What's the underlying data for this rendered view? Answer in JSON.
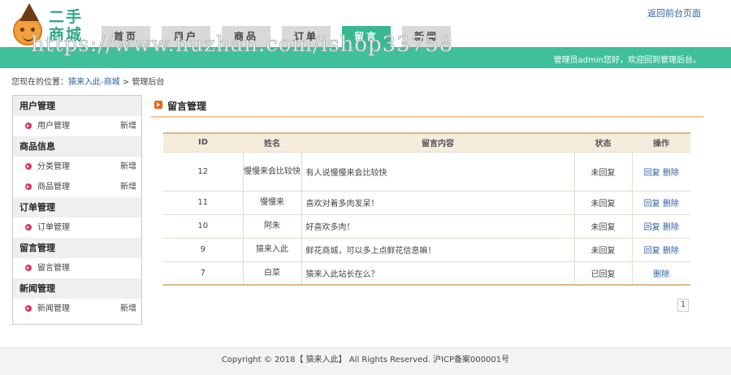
{
  "header": {
    "logo_line1": "二手",
    "logo_line2": "商城",
    "back_link": "返回前台页面",
    "welcome": "管理员admin您好，欢迎回到管理后台。",
    "watermark": "https://www.huzhan.com/ishop33758"
  },
  "nav": {
    "tabs": [
      {
        "label": "首页",
        "active": false
      },
      {
        "label": "用户",
        "active": false
      },
      {
        "label": "商品",
        "active": false
      },
      {
        "label": "订单",
        "active": false
      },
      {
        "label": "留言",
        "active": true
      },
      {
        "label": "新闻",
        "active": false
      }
    ]
  },
  "breadcrumb": {
    "prefix": "您现在的位置：",
    "site": "猿来入此-商城",
    "sep": ">",
    "current": "管理后台"
  },
  "sidebar": {
    "groups": [
      {
        "title": "用户管理",
        "items": [
          {
            "label": "用户管理",
            "add": "新增"
          }
        ]
      },
      {
        "title": "商品信息",
        "items": [
          {
            "label": "分类管理",
            "add": "新增"
          },
          {
            "label": "商品管理",
            "add": "新增"
          }
        ]
      },
      {
        "title": "订单管理",
        "items": [
          {
            "label": "订单管理",
            "add": ""
          }
        ]
      },
      {
        "title": "留言管理",
        "items": [
          {
            "label": "留言管理",
            "add": ""
          }
        ]
      },
      {
        "title": "新闻管理",
        "items": [
          {
            "label": "新闻管理",
            "add": "新增"
          }
        ]
      }
    ]
  },
  "main": {
    "title": "留言管理",
    "columns": [
      "ID",
      "姓名",
      "留言内容",
      "状态",
      "操作"
    ],
    "rows": [
      {
        "id": "12",
        "name": "慢慢来会比较快",
        "content": "有人说慢慢来会比较快",
        "status": "未回复",
        "reply": "回复",
        "delete": "删除"
      },
      {
        "id": "11",
        "name": "慢慢来",
        "content": "喜欢对着多肉发呆！",
        "status": "未回复",
        "reply": "回复",
        "delete": "删除"
      },
      {
        "id": "10",
        "name": "阿朱",
        "content": "好喜欢多肉！",
        "status": "未回复",
        "reply": "回复",
        "delete": "删除"
      },
      {
        "id": "9",
        "name": "猿来入此",
        "content": "鲜花商城，可以多上点鲜花信息嘛！",
        "status": "未回复",
        "reply": "回复",
        "delete": "删除"
      },
      {
        "id": "7",
        "name": "白菜",
        "content": "猿来入此站长在么？",
        "status": "已回复",
        "reply": "",
        "delete": "删除"
      }
    ],
    "pager": "1"
  },
  "footer": {
    "text": "Copyright © 2018【 猿来入此】 All Rights Reserved. 沪ICP备案000001号"
  },
  "colors": {
    "accent": "#40c09a",
    "link": "#2b5fa5",
    "bullet": "#d9355d"
  }
}
